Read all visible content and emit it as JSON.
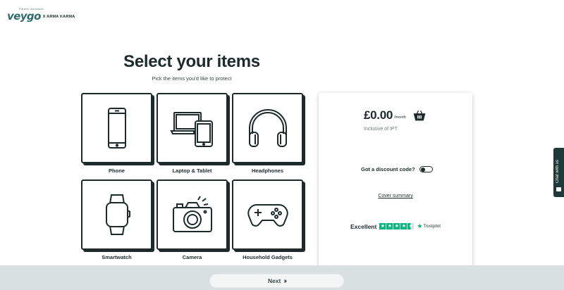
{
  "brand": {
    "tagline": "Partner insurance",
    "name": "veygo",
    "partner": "X ARMA KARMA"
  },
  "heading": {
    "title": "Select your items",
    "subtitle": "Pick the items you'd like to protect"
  },
  "items": [
    {
      "label": "Phone",
      "icon": "phone-icon"
    },
    {
      "label": "Laptop & Tablet",
      "icon": "laptop-tablet-icon"
    },
    {
      "label": "Headphones",
      "icon": "headphones-icon"
    },
    {
      "label": "Smartwatch",
      "icon": "smartwatch-icon"
    },
    {
      "label": "Camera",
      "icon": "camera-icon"
    },
    {
      "label": "Household Gadgets",
      "icon": "gamepad-icon"
    }
  ],
  "summary": {
    "price": "£0.00",
    "period": "/month",
    "ipt_note": "Inclusive of IPT",
    "discount_label": "Got a discount code?",
    "cover_link": "Cover summary",
    "rating_word": "Excellent",
    "trustpilot": "Trustpilot",
    "rating_stars": 4.5
  },
  "chat": {
    "label": "Chat with us"
  },
  "footer": {
    "next_label": "Next"
  },
  "colors": {
    "text": "#1e2a2a",
    "brand": "#2f6d6a",
    "footer_bg": "#d9e1e0",
    "trustpilot_green": "#00b67a"
  }
}
